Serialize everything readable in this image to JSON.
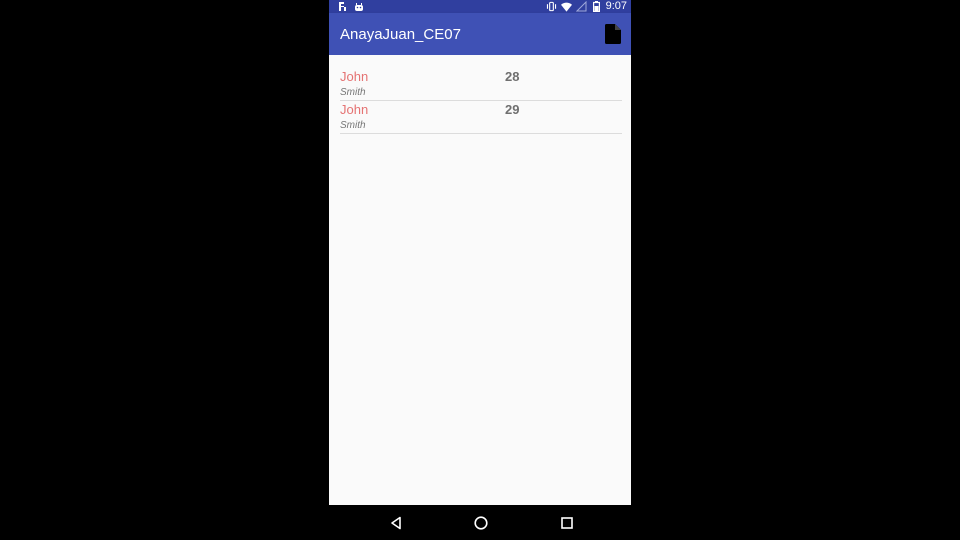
{
  "status_bar": {
    "time": "9:07",
    "left_icons": [
      "usb-debug-icon",
      "android-icon"
    ],
    "right_icons": [
      "vibrate-icon",
      "wifi-icon",
      "signal-icon",
      "battery-icon"
    ]
  },
  "app_bar": {
    "title": "AnayaJuan_CE07",
    "action_icon": "document-icon"
  },
  "people": [
    {
      "first_name": "John",
      "last_name": "Smith",
      "age": "28"
    },
    {
      "first_name": "John",
      "last_name": "Smith",
      "age": "29"
    }
  ],
  "nav_bar": {
    "buttons": [
      "back-icon",
      "home-icon",
      "recents-icon"
    ]
  },
  "colors": {
    "status_bar": "#303f9f",
    "app_bar": "#3f51b5",
    "first_name": "#e57373",
    "background": "#fafafa"
  }
}
